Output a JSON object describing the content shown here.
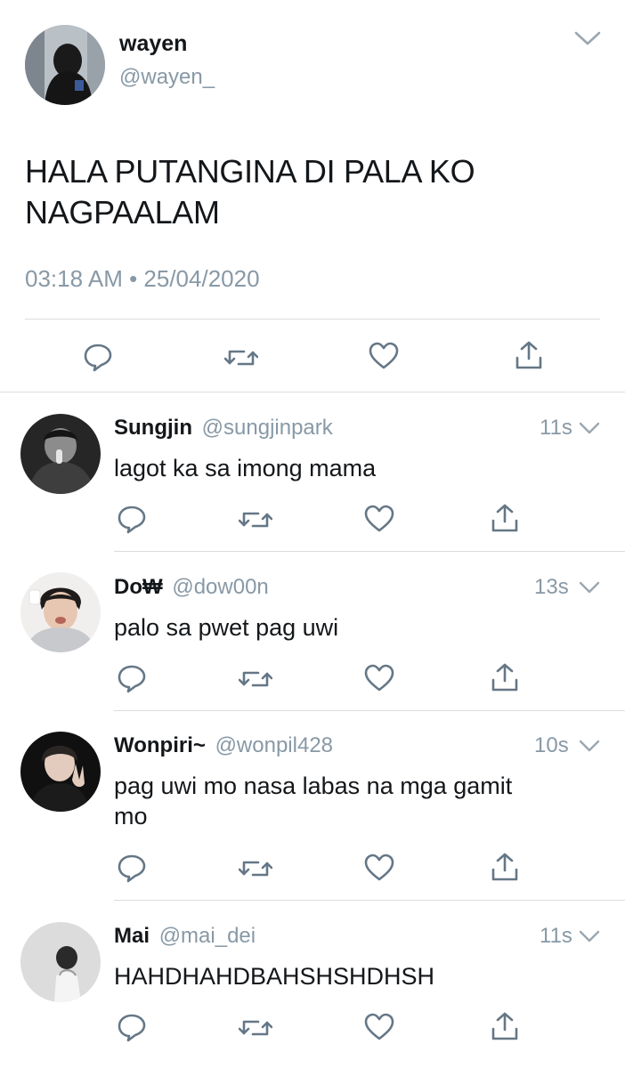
{
  "main_tweet": {
    "name": "wayen",
    "handle": "@wayen_",
    "text_line1": "HALA PUTANGINA DI PALA KO",
    "text_line2": "NAGPAALAM",
    "timestamp": "03:18 AM • 25/04/2020"
  },
  "replies": [
    {
      "name": "Sungjin",
      "handle": "@sungjinpark",
      "time": "11s",
      "text": "lagot ka sa imong mama"
    },
    {
      "name": "Do₩",
      "handle": "@dow00n",
      "time": "13s",
      "text": "palo sa pwet pag uwi"
    },
    {
      "name": "Wonpiri~",
      "handle": "@wonpil428",
      "time": "10s",
      "text_line1": "pag uwi mo nasa labas na mga gamit",
      "text_line2": "mo"
    },
    {
      "name": "Mai",
      "handle": "@mai_dei",
      "time": "11s",
      "text": "HAHDHAHDBAHSHSHDHSH"
    }
  ],
  "icons": {
    "reply": "reply-icon",
    "retweet": "retweet-icon",
    "like": "like-icon",
    "share": "share-icon",
    "more": "chevron-down-icon"
  },
  "colors": {
    "text": "#14171a",
    "muted": "#8899a6",
    "icon": "#657786",
    "divider": "#dbdde0"
  }
}
